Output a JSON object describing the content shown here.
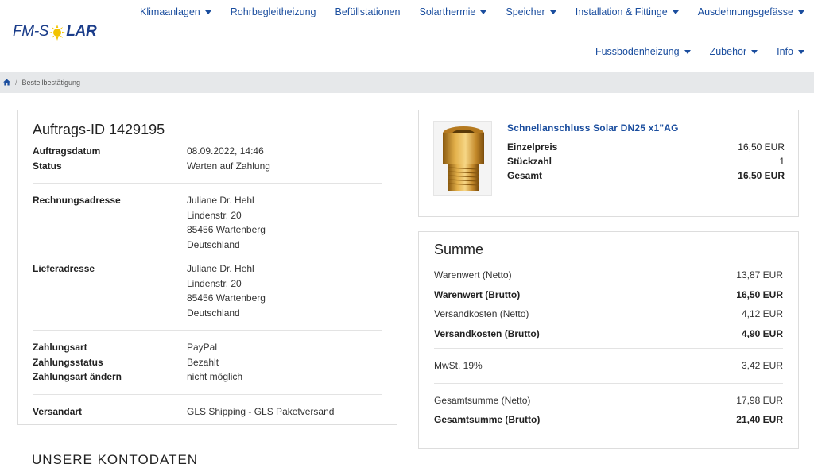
{
  "logo": {
    "part1": "FM-S",
    "part2": "LAR"
  },
  "nav": {
    "row1": [
      {
        "label": "Klimaanlagen",
        "caret": true
      },
      {
        "label": "Rohrbegleitheizung",
        "caret": false
      },
      {
        "label": "Befüllstationen",
        "caret": false
      },
      {
        "label": "Solarthermie",
        "caret": true
      },
      {
        "label": "Speicher",
        "caret": true
      },
      {
        "label": "Installation & Fittinge",
        "caret": true
      },
      {
        "label": "Ausdehnungsgefässe",
        "caret": true
      }
    ],
    "row2": [
      {
        "label": "Fussbodenheizung",
        "caret": true
      },
      {
        "label": "Zubehör",
        "caret": true
      },
      {
        "label": "Info",
        "caret": true
      }
    ]
  },
  "breadcrumb": {
    "sep": "/",
    "current": "Bestellbestätigung"
  },
  "order": {
    "title": "Auftrags-ID 1429195",
    "date_label": "Auftragsdatum",
    "date": "08.09.2022, 14:46",
    "status_label": "Status",
    "status": "Warten auf Zahlung",
    "billing_label": "Rechnungsadresse",
    "billing": [
      "Juliane Dr. Hehl",
      "Lindenstr. 20",
      "85456 Wartenberg",
      "Deutschland"
    ],
    "shipping_label": "Lieferadresse",
    "shipping": [
      "Juliane Dr. Hehl",
      "Lindenstr. 20",
      "85456 Wartenberg",
      "Deutschland"
    ],
    "payment_label": "Zahlungsart",
    "payment": "PayPal",
    "payment_status_label": "Zahlungsstatus",
    "payment_status": "Bezahlt",
    "change_payment_label": "Zahlungsart ändern",
    "change_payment": "nicht möglich",
    "shipping_method_label": "Versandart",
    "shipping_method": "GLS Shipping - GLS Paketversand"
  },
  "product": {
    "name": "Schnellanschluss Solar DN25 x1\"AG",
    "unit_price_label": "Einzelpreis",
    "unit_price": "16,50 EUR",
    "qty_label": "Stückzahl",
    "qty": "1",
    "total_label": "Gesamt",
    "total": "16,50 EUR"
  },
  "summary": {
    "title": "Summe",
    "goods_net_label": "Warenwert (Netto)",
    "goods_net": "13,87 EUR",
    "goods_gross_label": "Warenwert (Brutto)",
    "goods_gross": "16,50 EUR",
    "ship_net_label": "Versandkosten (Netto)",
    "ship_net": "4,12 EUR",
    "ship_gross_label": "Versandkosten (Brutto)",
    "ship_gross": "4,90 EUR",
    "vat_label": "MwSt. 19%",
    "vat": "3,42 EUR",
    "total_net_label": "Gesamtsumme (Netto)",
    "total_net": "17,98 EUR",
    "total_gross_label": "Gesamtsumme (Brutto)",
    "total_gross": "21,40 EUR"
  },
  "bottom_title": "UNSERE KONTODATEN",
  "colors": {
    "link": "#1a4d9e",
    "logo": "#1b3d8a",
    "sun": "#f2c300",
    "breadcrumb_bg": "#e6e8ea"
  }
}
